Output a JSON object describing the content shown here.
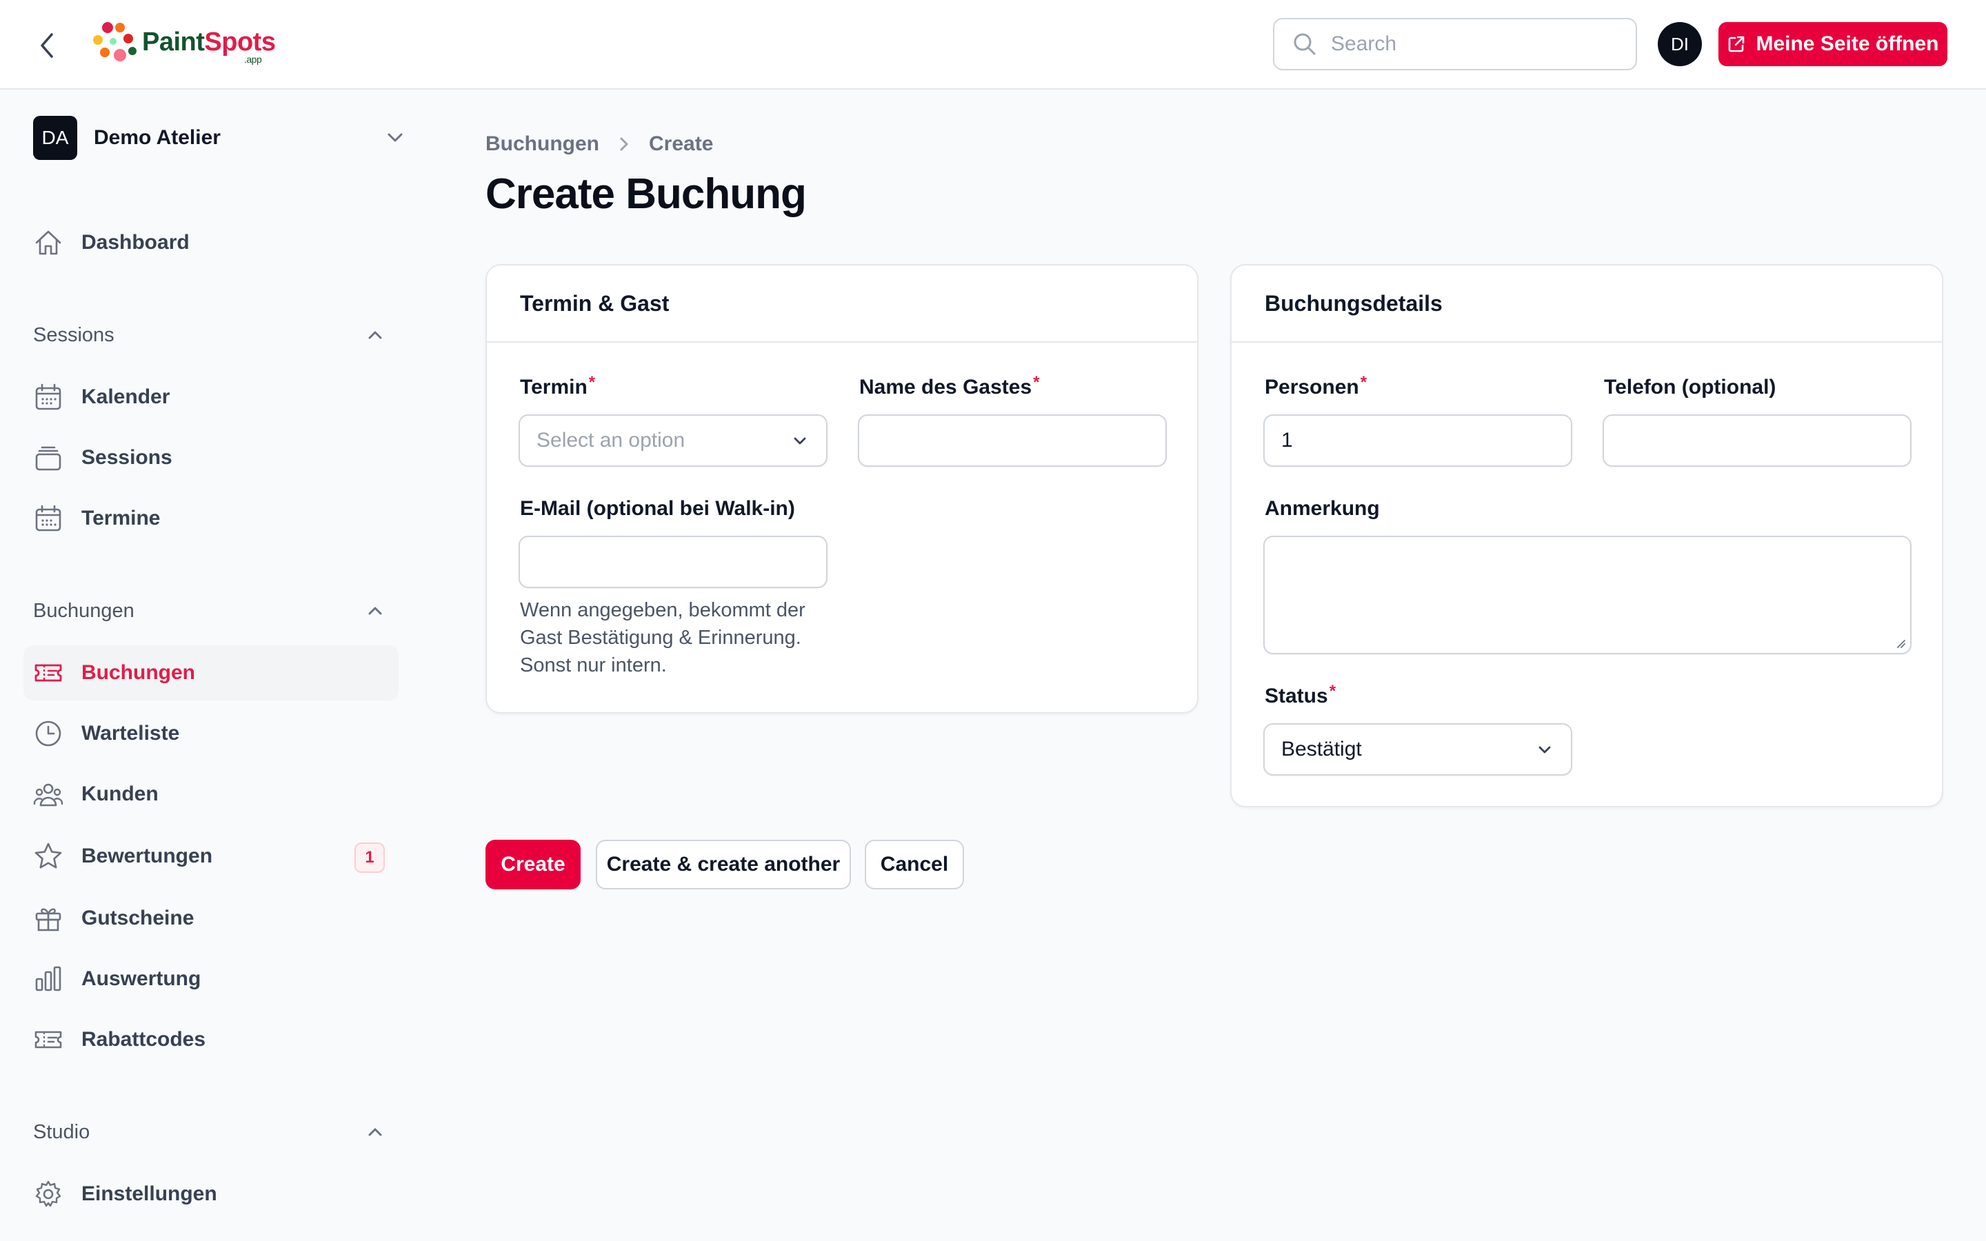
{
  "header": {
    "logo_paint": "Paint",
    "logo_spots": "Spots",
    "logo_app": ".app",
    "search_placeholder": "Search",
    "user_initials": "DI",
    "open_site_label": "Meine Seite öffnen"
  },
  "sidebar": {
    "tenant": {
      "initials": "DA",
      "name": "Demo Atelier"
    },
    "dashboard": {
      "label": "Dashboard",
      "icon": "home-icon"
    },
    "groups": [
      {
        "label": "Sessions",
        "items": [
          {
            "label": "Kalender",
            "icon": "calendar-icon"
          },
          {
            "label": "Sessions",
            "icon": "stack-icon"
          },
          {
            "label": "Termine",
            "icon": "calendar-grid-icon"
          }
        ]
      },
      {
        "label": "Buchungen",
        "items": [
          {
            "label": "Buchungen",
            "icon": "ticket-icon",
            "active": true
          },
          {
            "label": "Warteliste",
            "icon": "clock-icon"
          },
          {
            "label": "Kunden",
            "icon": "users-icon"
          },
          {
            "label": "Bewertungen",
            "icon": "star-icon",
            "badge": "1"
          },
          {
            "label": "Gutscheine",
            "icon": "gift-icon"
          },
          {
            "label": "Auswertung",
            "icon": "bar-chart-icon"
          },
          {
            "label": "Rabattcodes",
            "icon": "discount-ticket-icon"
          }
        ]
      },
      {
        "label": "Studio",
        "items": [
          {
            "label": "Einstellungen",
            "icon": "gear-icon"
          }
        ]
      }
    ]
  },
  "breadcrumb": {
    "parent": "Buchungen",
    "current": "Create"
  },
  "page_title": "Create Buchung",
  "card_termin": {
    "title": "Termin & Gast",
    "termin_label": "Termin",
    "termin_placeholder": "Select an option",
    "gast_label": "Name des Gastes",
    "gast_value": "",
    "email_label": "E-Mail (optional bei Walk-in)",
    "email_value": "",
    "email_helper": "Wenn angegeben, bekommt der Gast Bestätigung & Erinnerung. Sonst nur intern."
  },
  "card_details": {
    "title": "Buchungsdetails",
    "personen_label": "Personen",
    "personen_value": "1",
    "telefon_label": "Telefon (optional)",
    "telefon_value": "",
    "anmerkung_label": "Anmerkung",
    "anmerkung_value": "",
    "status_label": "Status",
    "status_value": "Bestätigt"
  },
  "actions": {
    "create": "Create",
    "create_another": "Create & create another",
    "cancel": "Cancel"
  },
  "colors": {
    "accent": "#e8003d",
    "brand_green": "#14532d",
    "active_text": "#e11d48"
  }
}
